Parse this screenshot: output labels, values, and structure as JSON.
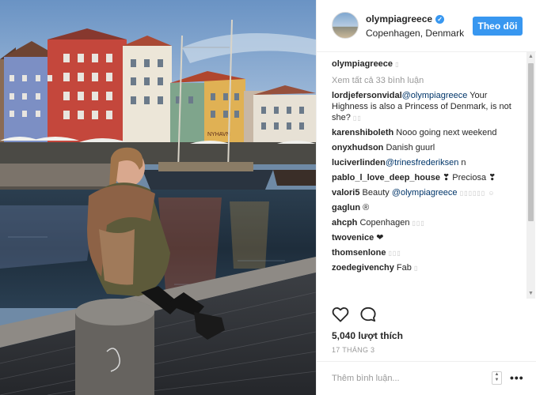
{
  "post": {
    "username": "olympiagreece",
    "location": "Copenhagen, Denmark",
    "follow_label": "Theo dõi",
    "verified_glyph": "✓"
  },
  "comments": {
    "caption_user": "olympiagreece",
    "caption_text": "▯",
    "view_all": "Xem tất cả 33 bình luận",
    "items": [
      {
        "user": "lordjefersonvidal",
        "mention": "@olympiagreece",
        "text": " Your Highness is also a Princess of Denmark, is not she? ",
        "extra": "▯▯"
      },
      {
        "user": "karenshiboleth",
        "mention": "",
        "text": " Nooo going next weekend",
        "extra": ""
      },
      {
        "user": "onyxhudson",
        "mention": "",
        "text": " Danish guurl",
        "extra": ""
      },
      {
        "user": "luciverlinden",
        "mention": "@trinesfrederiksen",
        "text": " n",
        "extra": ""
      },
      {
        "user": "pablo_l_love_deep_house",
        "mention": "",
        "text": " ❣ Preciosa ❣",
        "extra": ""
      },
      {
        "user": "valori5",
        "mention": "",
        "text": " Beauty ",
        "mention2": "@olympiagreece",
        "extra": " ▯▯▯▯▯▯ ☺"
      },
      {
        "user": "gaglun",
        "mention": "",
        "text": " ®",
        "extra": ""
      },
      {
        "user": "ahcph",
        "mention": "",
        "text": " Copenhagen ",
        "extra": "▯▯▯"
      },
      {
        "user": "twovenice",
        "mention": "",
        "text": " ❤",
        "extra": ""
      },
      {
        "user": "thomsenlone",
        "mention": "",
        "text": " ",
        "extra": "▯▯▯"
      },
      {
        "user": "zoedegivenchy",
        "mention": "",
        "text": " Fab ",
        "extra": "▯"
      }
    ]
  },
  "footer": {
    "likes": "5,040 lượt thích",
    "date": "17 THÁNG 3",
    "comment_placeholder": "Thêm bình luận...",
    "more_label": "•••",
    "spinner_up": "▲",
    "spinner_down": "▼"
  },
  "scrollbar": {
    "up_glyph": "▲",
    "down_glyph": "▼"
  },
  "photo_sign": {
    "shop_sign": "NYHAVN"
  },
  "icons": [
    "heart-icon",
    "comment-icon",
    "verified-icon",
    "more-icon"
  ],
  "colors": {
    "accent": "#3897f0",
    "text": "#262626",
    "muted": "#999999"
  }
}
